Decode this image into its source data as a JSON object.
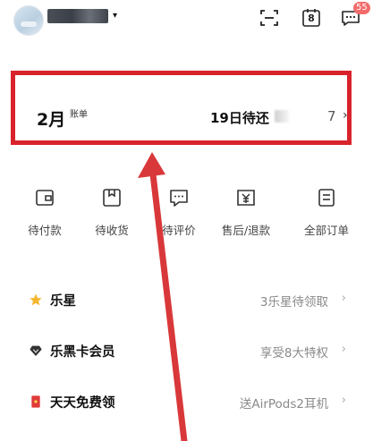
{
  "header": {
    "scan_icon": "scan-icon",
    "calendar_icon": "calendar-icon",
    "calendar_day": "8",
    "message_icon": "message-icon",
    "message_badge": "55",
    "nick_arrow": "▾"
  },
  "bill": {
    "month": "2月",
    "suffix": "账单",
    "due_text": "19日待还",
    "amount_tail": "7",
    "chevron": "›"
  },
  "orders": [
    {
      "label": "待付款",
      "icon": "wallet-icon"
    },
    {
      "label": "待收货",
      "icon": "package-icon"
    },
    {
      "label": "待评价",
      "icon": "comment-icon"
    },
    {
      "label": "售后/退款",
      "icon": "refund-icon"
    },
    {
      "label": "全部订单",
      "icon": "list-icon"
    }
  ],
  "list": [
    {
      "label": "乐星",
      "value": "3乐星待领取",
      "icon": "star-icon",
      "icon_color": "#f5b732"
    },
    {
      "label": "乐黑卡会员",
      "value": "享受8大特权",
      "icon": "diamond-icon",
      "icon_color": "#333333"
    },
    {
      "label": "天天免费领",
      "value": "送AirPods2耳机",
      "icon": "red-envelope-icon",
      "icon_color": "#e03a3a"
    }
  ],
  "colors": {
    "highlight_border": "#d9232b",
    "arrow": "#d9383a",
    "badge": "#f36b6b"
  }
}
